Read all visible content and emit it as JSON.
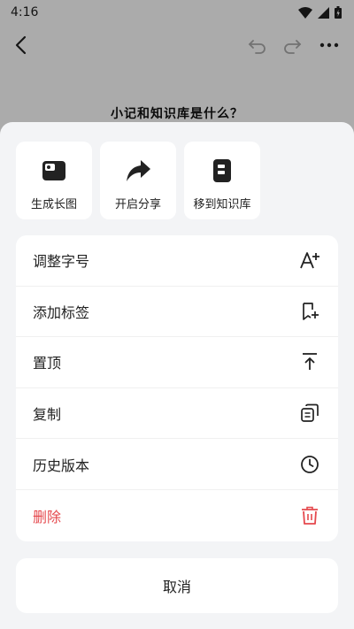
{
  "status_bar": {
    "time": "4:16"
  },
  "note": {
    "title": "小记和知识库是什么？"
  },
  "quick_actions": [
    {
      "label": "生成长图",
      "icon": "image-icon"
    },
    {
      "label": "开启分享",
      "icon": "share-icon"
    },
    {
      "label": "移到知识库",
      "icon": "knowledge-base-icon"
    }
  ],
  "menu": [
    {
      "label": "调整字号",
      "icon": "font-size-icon"
    },
    {
      "label": "添加标签",
      "icon": "add-tag-icon"
    },
    {
      "label": "置顶",
      "icon": "pin-top-icon"
    },
    {
      "label": "复制",
      "icon": "copy-icon"
    },
    {
      "label": "历史版本",
      "icon": "history-icon"
    },
    {
      "label": "删除",
      "icon": "delete-icon"
    }
  ],
  "cancel_label": "取消",
  "colors": {
    "danger": "#e5484d",
    "sheet_bg": "#f3f4f6",
    "scrim": "rgba(0,0,0,0.33)"
  }
}
